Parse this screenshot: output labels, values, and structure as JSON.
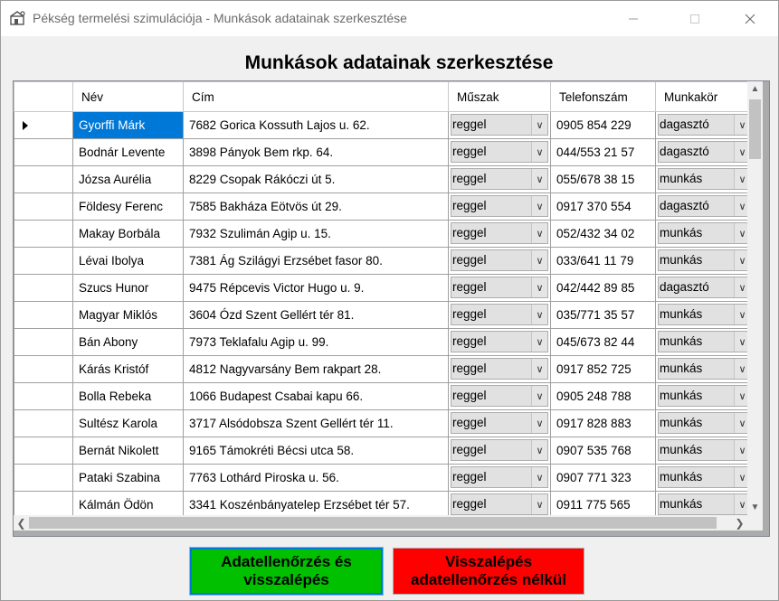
{
  "window": {
    "title": "Pékség termelési szimulációja - Munkások adatainak szerkesztése",
    "icon": "bakery-icon",
    "controls": {
      "minimize": "minimize-icon",
      "maximize": "maximize-icon",
      "close": "close-icon"
    }
  },
  "heading": "Munkások adatainak szerkesztése",
  "grid": {
    "columns": [
      "Név",
      "Cím",
      "Műszak",
      "Telefonszám",
      "Munkakör"
    ],
    "selected_row": 0,
    "rows": [
      {
        "nev": "Gyorffi Márk",
        "cim": "7682 Gorica Kossuth Lajos u. 62.",
        "muszak": "reggel",
        "telefon": "0905 854 229",
        "munkakor": "dagasztó"
      },
      {
        "nev": "Bodnár Levente",
        "cim": "3898 Pányok Bem rkp. 64.",
        "muszak": "reggel",
        "telefon": "044/553 21 57",
        "munkakor": "dagasztó"
      },
      {
        "nev": "Józsa Aurélia",
        "cim": "8229 Csopak Rákóczi út 5.",
        "muszak": "reggel",
        "telefon": "055/678 38 15",
        "munkakor": "munkás"
      },
      {
        "nev": "Földesy Ferenc",
        "cim": "7585 Bakháza Eötvös út 29.",
        "muszak": "reggel",
        "telefon": "0917 370 554",
        "munkakor": "dagasztó"
      },
      {
        "nev": "Makay Borbála",
        "cim": "7932 Szulimán Agip u. 15.",
        "muszak": "reggel",
        "telefon": "052/432 34 02",
        "munkakor": "munkás"
      },
      {
        "nev": "Lévai Ibolya",
        "cim": "7381 Ág Szilágyi Erzsébet fasor 80.",
        "muszak": "reggel",
        "telefon": "033/641 11 79",
        "munkakor": "munkás"
      },
      {
        "nev": "Szucs Hunor",
        "cim": "9475 Répcevis Victor Hugo u. 9.",
        "muszak": "reggel",
        "telefon": "042/442 89 85",
        "munkakor": "dagasztó"
      },
      {
        "nev": "Magyar Miklós",
        "cim": "3604 Ózd Szent Gellért tér 81.",
        "muszak": "reggel",
        "telefon": "035/771 35 57",
        "munkakor": "munkás"
      },
      {
        "nev": "Bán Abony",
        "cim": "7973 Teklafalu Agip u. 99.",
        "muszak": "reggel",
        "telefon": "045/673 82 44",
        "munkakor": "munkás"
      },
      {
        "nev": "Kárás Kristóf",
        "cim": "4812 Nagyvarsány Bem rakpart 28.",
        "muszak": "reggel",
        "telefon": "0917 852 725",
        "munkakor": "munkás"
      },
      {
        "nev": "Bolla Rebeka",
        "cim": "1066 Budapest Csabai kapu 66.",
        "muszak": "reggel",
        "telefon": "0905 248 788",
        "munkakor": "munkás"
      },
      {
        "nev": "Sultész Karola",
        "cim": "3717 Alsódobsza Szent Gellért tér 11.",
        "muszak": "reggel",
        "telefon": "0917 828 883",
        "munkakor": "munkás"
      },
      {
        "nev": "Bernát Nikolett",
        "cim": "9165 Támokréti Bécsi utca 58.",
        "muszak": "reggel",
        "telefon": "0907 535 768",
        "munkakor": "munkás"
      },
      {
        "nev": "Pataki Szabina",
        "cim": "7763 Lothárd Piroska u. 56.",
        "muszak": "reggel",
        "telefon": "0907 771 323",
        "munkakor": "munkás"
      },
      {
        "nev": "Kálmán Ödön",
        "cim": "3341 Koszénbányatelep Erzsébet tér 57.",
        "muszak": "reggel",
        "telefon": "0911 775 565",
        "munkakor": "munkás"
      }
    ]
  },
  "buttons": {
    "confirm": [
      "Adatellenőrzés és",
      "visszalépés"
    ],
    "cancel": [
      "Visszalépés",
      "adatellenőrzés nélkül"
    ]
  },
  "colors": {
    "selection": "#0078d7",
    "confirm_button": "#00c000",
    "cancel_button": "#ff0000"
  }
}
